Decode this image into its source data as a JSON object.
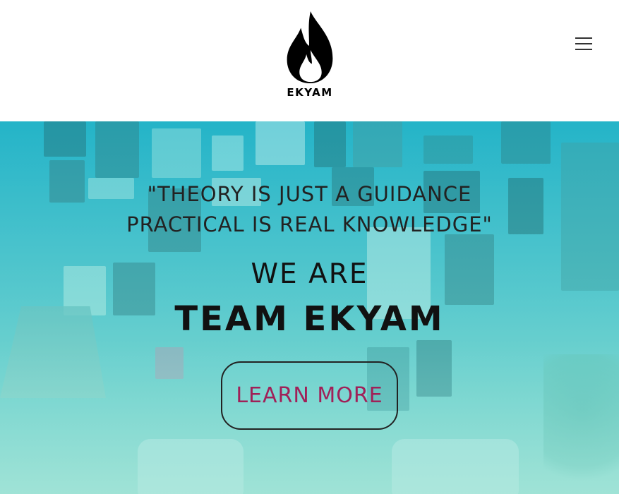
{
  "header": {
    "logo_text": "EKYAM",
    "logo_icon": "flame-icon",
    "menu_icon": "hamburger-menu-icon"
  },
  "hero": {
    "quote_line1": "\"THEORY IS JUST A GUIDANCE",
    "quote_line2": "PRACTICAL IS REAL KNOWLEDGE\"",
    "subtitle": "WE ARE",
    "title": "TEAM EKYAM",
    "cta_label": "LEARN MORE"
  },
  "colors": {
    "header_bg": "#ffffff",
    "hero_tint": "#1fb3c8",
    "cta_text": "#a02058",
    "text_dark": "#111111"
  }
}
